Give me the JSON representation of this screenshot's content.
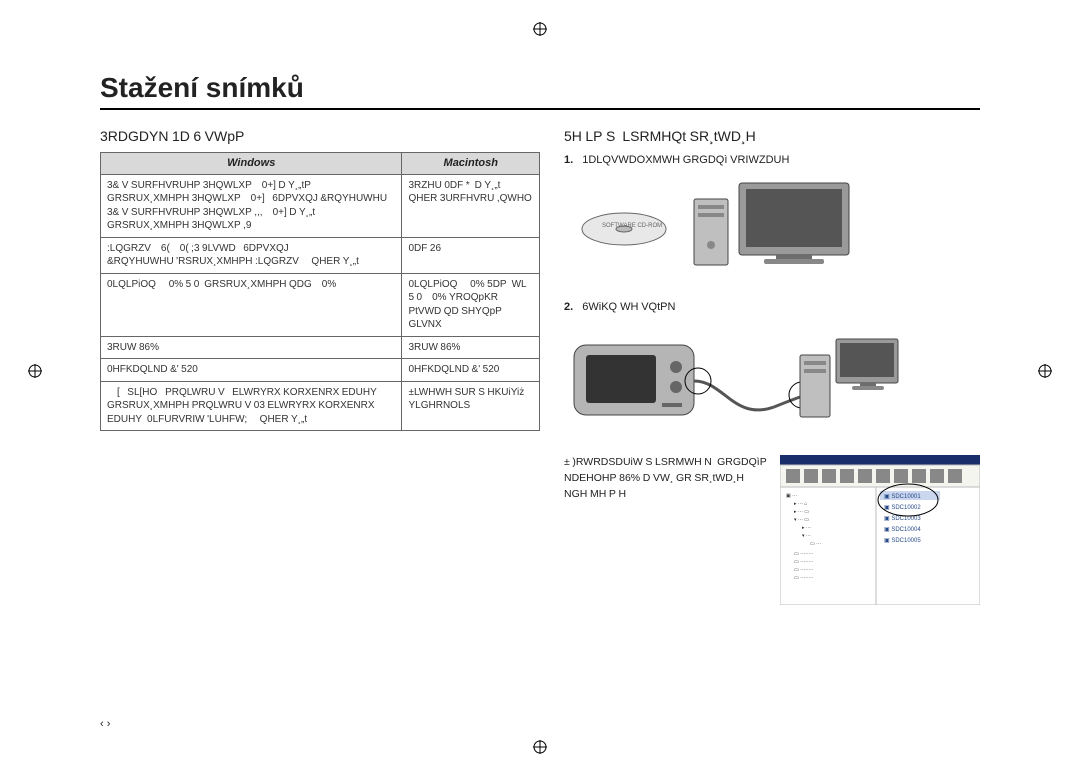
{
  "title": "Stažení snímků",
  "left_heading": "3RDGDYN 1D 6 VWpP",
  "right_heading": "5H LP S  LSRMHQt SR¸tWD¸H",
  "table": {
    "headers": [
      "Windows",
      "Macintosh"
    ],
    "rows": [
      [
        "3& V SURFHVRUHP 3HQWLXP    0+] D Y¸„tP  GRSRUX¸XMHPH 3HQWLXP    0+]   6DPVXQJ &RQYHUWHU 3& V SURFHVRUHP 3HQWLXP ,,,    0+] D Y¸„t  GRSRUX¸XMHPH 3HQWLXP ,9",
        "3RZHU 0DF *  D Y¸„t QHER 3URFHVRU ,QWHO"
      ],
      [
        ":LQGRZV    6(    0( ;3 9LVWD   6DPVXQJ &RQYHUWHU 'RSRUX¸XMHPH :LQGRZV     QHER Y¸„t",
        "0DF 26           "
      ],
      [
        "0LQLPiOQ     0% 5 0  GRSRUX¸XMHPH QDG    0%",
        "0LQLPiOQ     0% 5DP  WL 5 0    0% YROQpKR PtVWD QD SHYQpP GLVNX"
      ],
      [
        "3RUW 86%",
        "3RUW 86%"
      ],
      [
        "0HFKDQLND &' 520",
        "0HFKDQLND &' 520"
      ],
      [
        "    [   SL[HO   PRQLWRU V   ELWRYRX KORXENRX EDUHY  GRSRUX¸XMHPH PRQLWRU V 03 ELWRYRX KORXENRX EDUHY  0LFURVRIW 'LUHFW;     QHER Y¸„t",
        "±LWHWH SUR S HKUiYiż YLGHRNOLS "
      ]
    ]
  },
  "steps": {
    "items": [
      {
        "num": "1.",
        "text": "1DLQVWDOXMWH GRGDQì VRIWZDUH "
      },
      {
        "num": "2.",
        "text": "6WiKQ WH VQtPN "
      }
    ],
    "footnote": "± )RWRDSDUiW S LSRMWH N  GRGDQìP NDEHOHP 86% D VW¸ GR SR¸tWD¸H NGH MH P H "
  },
  "page_number": "‹ ›"
}
